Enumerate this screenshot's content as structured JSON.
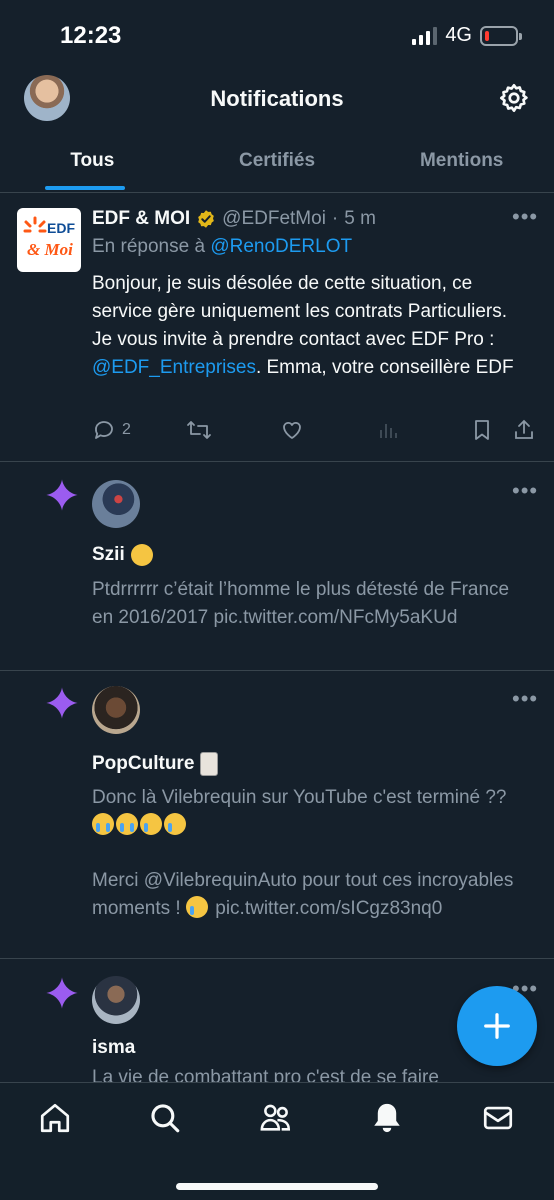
{
  "status_bar": {
    "time": "12:23",
    "network": "4G"
  },
  "header": {
    "title": "Notifications"
  },
  "tabs": [
    {
      "label": "Tous",
      "active": true
    },
    {
      "label": "Certifiés",
      "active": false
    },
    {
      "label": "Mentions",
      "active": false
    }
  ],
  "tweet": {
    "logo_text_top": "EDF",
    "logo_text_bottom": "& Moi",
    "author_name": "EDF & MOI",
    "handle": "@EDFetMoi",
    "separator": "·",
    "time": "5 m",
    "reply_prefix": "En réponse à",
    "reply_to": "@RenoDERLOT",
    "body_part1": "Bonjour, je suis désolée de cette situation, ce service gère uniquement les contrats Particuliers. Je vous invite à prendre contact avec EDF Pro : ",
    "body_mention": "@EDF_Entreprises",
    "body_part2": ". Emma, votre conseillère EDF",
    "reply_count": "2",
    "more": "•••"
  },
  "notifications": [
    {
      "name": "Szii",
      "text": "Ptdrrrrrr c’était l’homme le plus détesté de France en 2016/2017 pic.twitter.com/NFcMy5aKUd",
      "more": "•••"
    },
    {
      "name": "PopCulture",
      "text_line1": "Donc là Vilebrequin sur YouTube c'est terminé ??",
      "text_line2": "Merci @VilebrequinAuto pour tout ces incroyables moments !",
      "text_link": "pic.twitter.com/sICgz83nq0",
      "more": "•••"
    },
    {
      "name": "isma",
      "text": "La vie de combattant pro c'est de se faire",
      "more": "•••"
    }
  ],
  "colors": {
    "background": "#15202b",
    "accent": "#1d9bf0",
    "muted": "#8b98a5",
    "spark": "#9b5cf0",
    "verified": "#e2b719"
  },
  "icons": {
    "nav": [
      "home-icon",
      "search-icon",
      "communities-icon",
      "notifications-icon",
      "messages-icon"
    ],
    "fab": "plus-icon"
  }
}
